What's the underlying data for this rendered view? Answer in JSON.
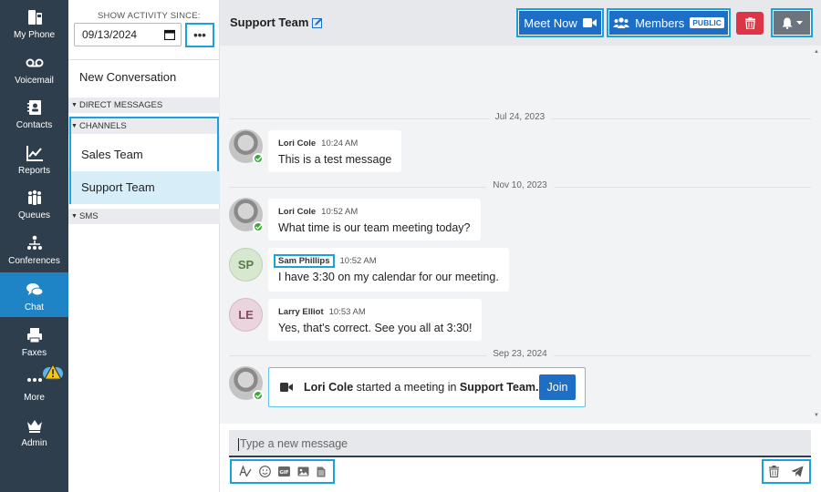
{
  "nav": {
    "items": [
      {
        "label": "My Phone",
        "icon": "phone-icon"
      },
      {
        "label": "Voicemail",
        "icon": "voicemail-icon"
      },
      {
        "label": "Contacts",
        "icon": "contacts-icon"
      },
      {
        "label": "Reports",
        "icon": "reports-icon"
      },
      {
        "label": "Queues",
        "icon": "queues-icon"
      },
      {
        "label": "Conferences",
        "icon": "conferences-icon"
      },
      {
        "label": "Chat",
        "icon": "chat-icon",
        "active": true
      },
      {
        "label": "Faxes",
        "icon": "fax-icon"
      },
      {
        "label": "More",
        "icon": "more-icon",
        "warning": true
      },
      {
        "label": "Admin",
        "icon": "admin-crown-icon"
      }
    ]
  },
  "sidebar": {
    "since_label": "SHOW ACTIVITY SINCE:",
    "date_value": "09/13/2024",
    "more_label": "•••",
    "new_conversation": "New Conversation",
    "sections": {
      "direct": "DIRECT MESSAGES",
      "channels": "CHANNELS",
      "sms": "SMS"
    },
    "channels": [
      "Sales Team",
      "Support Team"
    ],
    "selected_channel": "Support Team"
  },
  "header": {
    "title": "Support Team",
    "meet_now": "Meet Now",
    "members": "Members",
    "public_badge": "PUBLIC"
  },
  "chat": {
    "dates": [
      "Jul 24, 2023",
      "Nov 10, 2023",
      "Sep 23, 2024"
    ],
    "messages": [
      {
        "name": "Lori Cole",
        "time": "10:24 AM",
        "text": "This is a test message"
      },
      {
        "name": "Lori Cole",
        "time": "10:52 AM",
        "text": "What time is our team meeting today?"
      },
      {
        "name": "Sam Phillips",
        "initials": "SP",
        "time": "10:52 AM",
        "text": "I have 3:30 on my calendar for our meeting."
      },
      {
        "name": "Larry Elliot",
        "initials": "LE",
        "time": "10:53 AM",
        "text": "Yes, that's correct. See you all at 3:30!"
      }
    ],
    "meeting": {
      "who": "Lori Cole",
      "middle": " started a meeting in ",
      "channel": "Support Team.",
      "join": "Join"
    }
  },
  "composer": {
    "placeholder": "Type a new message"
  },
  "colors": {
    "nav_bg": "#2f3e4c",
    "accent": "#1f6ec6",
    "highlight": "#1aa2dc",
    "danger": "#dc3545",
    "online": "#3aa935"
  }
}
